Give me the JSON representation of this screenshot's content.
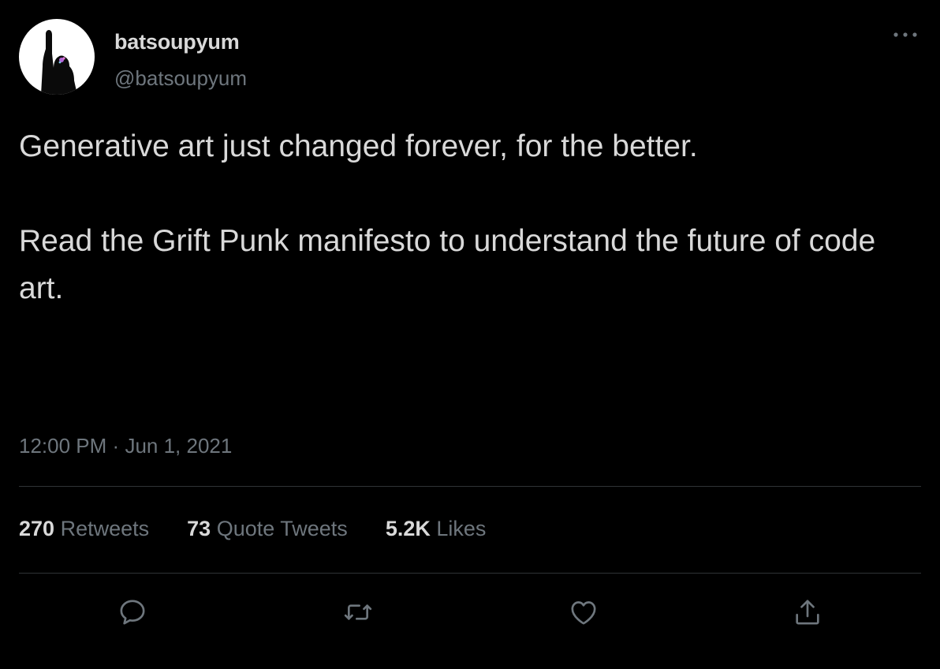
{
  "author": {
    "display_name": "batsoupyum",
    "handle": "@batsoupyum"
  },
  "tweet": {
    "paragraphs": [
      "Generative art just changed forever, for the better.",
      "Read the Grift Punk manifesto to understand the future of code art."
    ],
    "time": "12:00 PM",
    "separator": "·",
    "date": "Jun 1, 2021"
  },
  "stats": {
    "retweets": {
      "count": "270",
      "label": "Retweets"
    },
    "quote_tweets": {
      "count": "73",
      "label": "Quote Tweets"
    },
    "likes": {
      "count": "5.2K",
      "label": "Likes"
    }
  },
  "actions": [
    {
      "icon": "reply-icon"
    },
    {
      "icon": "retweet-icon"
    },
    {
      "icon": "like-icon"
    },
    {
      "icon": "share-icon"
    }
  ],
  "colors": {
    "background": "#000000",
    "primary_text": "#d9d9d9",
    "secondary_text": "#6e767d",
    "divider": "#2f3336"
  }
}
